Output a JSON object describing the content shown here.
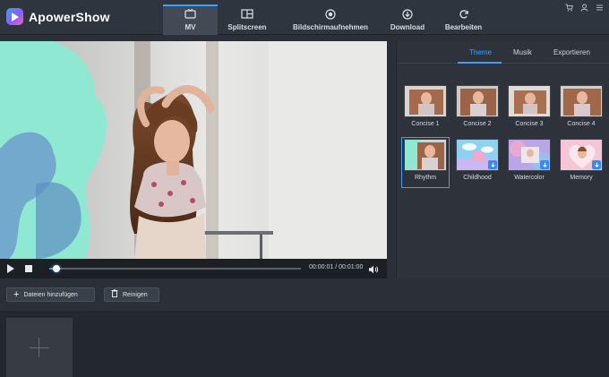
{
  "app": {
    "name": "ApowerShow"
  },
  "nav": {
    "mv": "MV",
    "splitscreen": "Splitscreen",
    "record": "Bildschirmaufnehmen",
    "download": "Download",
    "edit": "Bearbeiten"
  },
  "player": {
    "time_current": "00:00:01",
    "time_separator": " / ",
    "time_total": "00:01:00",
    "progress_fraction": 0.02
  },
  "panel": {
    "tabs": [
      "Theme",
      "Musik",
      "Exportieren"
    ],
    "active_tab": "Theme",
    "themes": [
      {
        "label": "Concise 1",
        "selected": false,
        "download": false
      },
      {
        "label": "Concise 2",
        "selected": false,
        "download": false
      },
      {
        "label": "Concise 3",
        "selected": false,
        "download": false
      },
      {
        "label": "Concise 4",
        "selected": false,
        "download": false
      },
      {
        "label": "Rhythm",
        "selected": true,
        "download": false
      },
      {
        "label": "Childhood",
        "selected": false,
        "download": true
      },
      {
        "label": "Watercolor",
        "selected": false,
        "download": true
      },
      {
        "label": "Memory",
        "selected": false,
        "download": true
      }
    ]
  },
  "toolbar": {
    "add_files": "Dateien hinzufügen",
    "clear": "Reinigen"
  },
  "colors": {
    "accent": "#3aa0ff",
    "background": "#2b3038",
    "panel": "#2e333b"
  }
}
